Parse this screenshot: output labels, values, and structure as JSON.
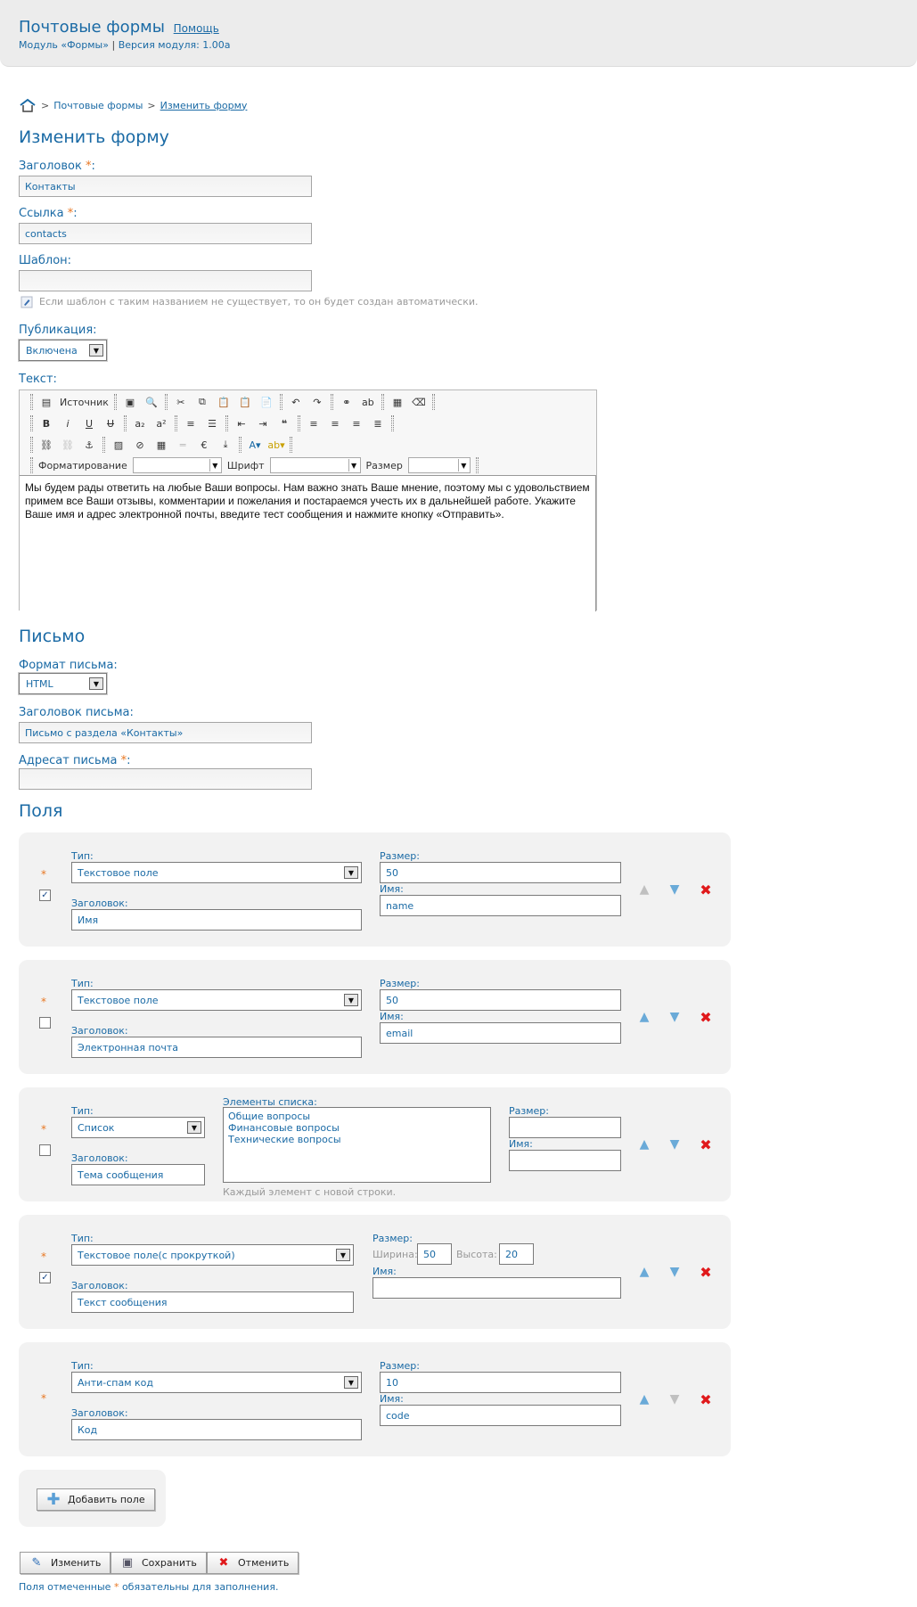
{
  "header": {
    "title": "Почтовые формы",
    "help": "Помощь",
    "module": "Модуль «Формы»",
    "separator": "|",
    "version": "Версия модуля: 1.00a"
  },
  "breadcrumb": {
    "arrow": ">",
    "items": [
      "Почтовые формы",
      "Изменить форму"
    ]
  },
  "page_title": "Изменить форму",
  "form": {
    "title_label": "Заголовок",
    "title_value": "Контакты",
    "link_label": "Ссылка",
    "link_value": "contacts",
    "template_label": "Шаблон:",
    "template_value": "",
    "template_hint": "Если шаблон с таким названием не существует, то он будет создан автоматически.",
    "publish_label": "Публикация:",
    "publish_value": "Включена",
    "text_label": "Текст:",
    "required_mark": "*",
    "colon": ":"
  },
  "editor": {
    "source": "Источник",
    "format": "Форматирование",
    "font": "Шрифт",
    "size": "Размер",
    "body": "Мы будем рады ответить на любые Ваши вопросы. Нам важно знать Ваше мнение, поэтому мы с удовольствием примем все Ваши отзывы, комментарии и пожелания и постараемся учесть их в дальнейшей работе. Укажите Ваше имя и адрес электронной почты, введите тест сообщения и нажмите кнопку «Отправить»."
  },
  "letter": {
    "heading": "Письмо",
    "format_label": "Формат письма:",
    "format_value": "HTML",
    "subject_label": "Заголовок письма:",
    "subject_value": "Письмо с раздела «Контакты»",
    "recipient_label": "Адресат письма",
    "recipient_value": ""
  },
  "fields": {
    "heading": "Поля",
    "type_label": "Тип:",
    "caption_label": "Заголовок:",
    "size_label": "Размер:",
    "name_label": "Имя:",
    "list_label": "Элементы списка:",
    "list_hint": "Каждый элемент с новой строки.",
    "width_label": "Ширина:",
    "height_label": "Высота:",
    "items": [
      {
        "type": "Текстовое поле",
        "caption": "Имя",
        "size": "50",
        "name": "name",
        "checked": true
      },
      {
        "type": "Текстовое поле",
        "caption": "Электронная почта",
        "size": "50",
        "name": "email",
        "checked": false
      },
      {
        "type": "Список",
        "caption": "Тема сообщения",
        "size": "",
        "name": "",
        "checked": false,
        "list": [
          "Общие вопросы",
          "Финансовые вопросы",
          "Технические вопросы"
        ]
      },
      {
        "type": "Текстовое поле(с прокруткой)",
        "caption": "Текст сообщения",
        "width": "50",
        "height": "20",
        "name": "",
        "checked": true
      },
      {
        "type": "Анти-спам код",
        "caption": "Код",
        "size": "10",
        "name": "code"
      }
    ]
  },
  "buttons": {
    "add_field": "Добавить поле",
    "edit": "Изменить",
    "save": "Сохранить",
    "cancel": "Отменить"
  },
  "footnote": {
    "before": "Поля отмеченные",
    "star": "*",
    "after": "обязательны для заполнения."
  },
  "colors": {
    "accent": "#1a6aa5",
    "required": "#e87722",
    "delete": "#e0191b",
    "card_bg": "#f2f2f2"
  }
}
